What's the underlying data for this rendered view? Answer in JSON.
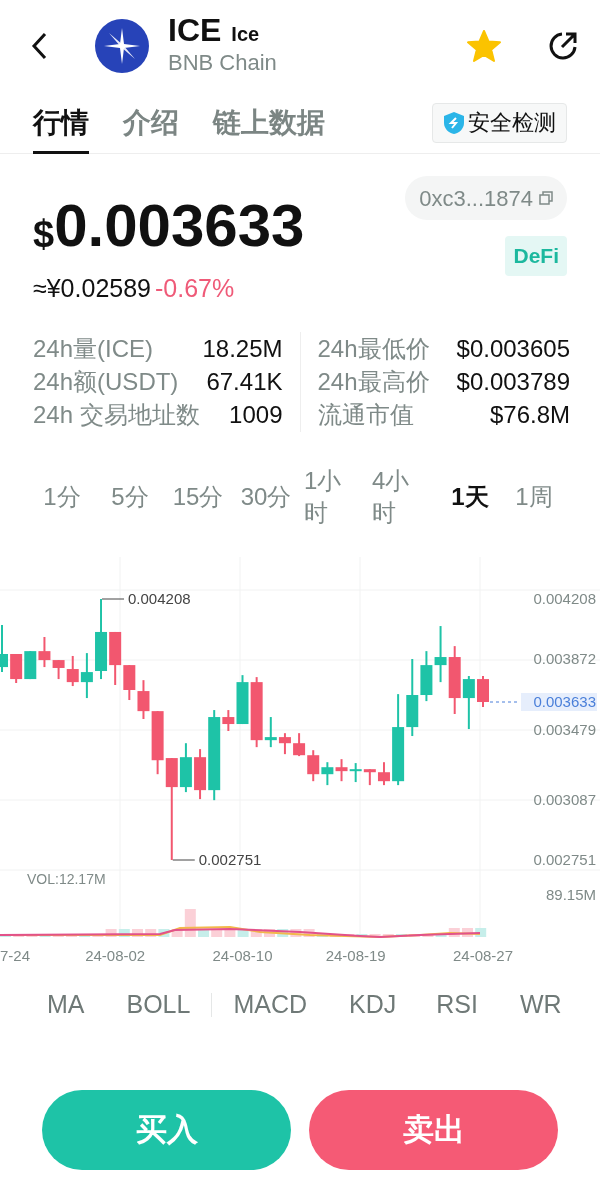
{
  "header": {
    "symbol": "ICE",
    "name": "Ice",
    "chain": "BNB Chain",
    "favorited": true
  },
  "tabs": [
    {
      "label": "行情",
      "selected": true
    },
    {
      "label": "介绍",
      "selected": false
    },
    {
      "label": "链上数据",
      "selected": false
    }
  ],
  "security_button": "安全检测",
  "price": {
    "currency_symbol": "$",
    "value": "0.003633",
    "fiat": "≈¥0.02589",
    "change": "-0.67%",
    "falling": true
  },
  "contract": "0xc3...1874",
  "tag": "DeFi",
  "stats_left": [
    {
      "label": "24h量(ICE)",
      "value": "18.25M"
    },
    {
      "label": "24h额(USDT)",
      "value": "67.41K"
    },
    {
      "label": "24h 交易地址数",
      "value": "1009"
    }
  ],
  "stats_right": [
    {
      "label": "24h最低价",
      "value": "$0.003605"
    },
    {
      "label": "24h最高价",
      "value": "$0.003789"
    },
    {
      "label": "流通市值",
      "value": "$76.8M"
    }
  ],
  "intervals": [
    {
      "label": "1分",
      "selected": false
    },
    {
      "label": "5分",
      "selected": false
    },
    {
      "label": "15分",
      "selected": false
    },
    {
      "label": "30分",
      "selected": false
    },
    {
      "label": "1小时",
      "selected": false
    },
    {
      "label": "4小时",
      "selected": false
    },
    {
      "label": "1天",
      "selected": true
    },
    {
      "label": "1周",
      "selected": false
    }
  ],
  "chart": {
    "chart_data": {
      "type": "candlestick",
      "categories": [
        null,
        null,
        null,
        null,
        null,
        null,
        null,
        null,
        "24-08-02",
        null,
        null,
        null,
        null,
        null,
        null,
        null,
        null,
        "24-08-10",
        null,
        null,
        null,
        null,
        null,
        null,
        null,
        "24-08-19",
        null,
        null,
        null,
        null,
        null,
        null,
        null,
        null,
        "24-08-27"
      ],
      "ohlc": [
        [
          0.003828,
          0.004063,
          0.0038,
          0.003901
        ],
        [
          0.003901,
          0.003901,
          0.003739,
          0.003761
        ],
        [
          0.003761,
          0.003917,
          0.003761,
          0.003917
        ],
        [
          0.003917,
          0.003996,
          0.003828,
          0.003867
        ],
        [
          0.003867,
          0.003867,
          0.003761,
          0.003823
        ],
        [
          0.003817,
          0.00389,
          0.003722,
          0.003744
        ],
        [
          0.003744,
          0.003906,
          0.003655,
          0.0038
        ],
        [
          0.003806,
          0.004208,
          0.003761,
          0.004024
        ],
        [
          0.004024,
          0.004024,
          0.003728,
          0.003839
        ],
        [
          0.003839,
          0.003839,
          0.003644,
          0.0037
        ],
        [
          0.003694,
          0.003755,
          0.003538,
          0.003582
        ],
        [
          0.003582,
          0.003582,
          0.00323,
          0.003308
        ],
        [
          0.00332,
          0.00332,
          0.002751,
          0.003158
        ],
        [
          0.003158,
          0.003403,
          0.00313,
          0.003325
        ],
        [
          0.003325,
          0.00337,
          0.003091,
          0.003141
        ],
        [
          0.003141,
          0.003588,
          0.003085,
          0.003549
        ],
        [
          0.003549,
          0.003588,
          0.003471,
          0.00351
        ],
        [
          0.00351,
          0.003783,
          0.00351,
          0.003744
        ],
        [
          0.003744,
          0.003772,
          0.003381,
          0.00342
        ],
        [
          0.00342,
          0.003549,
          0.003381,
          0.003437
        ],
        [
          0.003437,
          0.003459,
          0.003342,
          0.003403
        ],
        [
          0.003403,
          0.003459,
          0.003331,
          0.003336
        ],
        [
          0.003336,
          0.003364,
          0.003191,
          0.00323
        ],
        [
          0.00323,
          0.003297,
          0.003169,
          0.003269
        ],
        [
          0.003269,
          0.003314,
          0.003191,
          0.003247
        ],
        [
          0.003247,
          0.003292,
          0.003186,
          0.003258
        ],
        [
          0.003258,
          0.003258,
          0.003169,
          0.003241
        ],
        [
          0.003241,
          0.003297,
          0.003169,
          0.003191
        ],
        [
          0.003191,
          0.003677,
          0.003169,
          0.003493
        ],
        [
          0.003493,
          0.003873,
          0.003443,
          0.003672
        ],
        [
          0.003672,
          0.003917,
          0.003638,
          0.003839
        ],
        [
          0.003839,
          0.004057,
          0.003744,
          0.003884
        ],
        [
          0.003884,
          0.003945,
          0.003566,
          0.003655
        ],
        [
          0.003655,
          0.003778,
          0.003482,
          0.003761
        ],
        [
          0.003761,
          0.003778,
          0.003605,
          0.003633
        ]
      ],
      "grid": true,
      "ylim": [
        0.002751,
        0.004208
      ],
      "yticks": [
        {
          "value": 0.004208,
          "label": "0.004208"
        },
        {
          "value": 0.003872,
          "label": "0.003872"
        },
        {
          "value": 0.003479,
          "label": "0.003479"
        },
        {
          "value": 0.003087,
          "label": "0.003087"
        },
        {
          "value": 0.002751,
          "label": "0.002751"
        }
      ],
      "annotations": [
        "0.004208",
        "0.002751",
        "0.003633"
      ]
    },
    "edge_date_label": "7-24",
    "volume_label": "VOL:12.17M",
    "volume_axis": "89.15M"
  },
  "indicators": [
    "MA",
    "BOLL",
    "MACD",
    "KDJ",
    "RSI",
    "WR"
  ],
  "buttons": {
    "buy": "买入",
    "sell": "卖出"
  }
}
